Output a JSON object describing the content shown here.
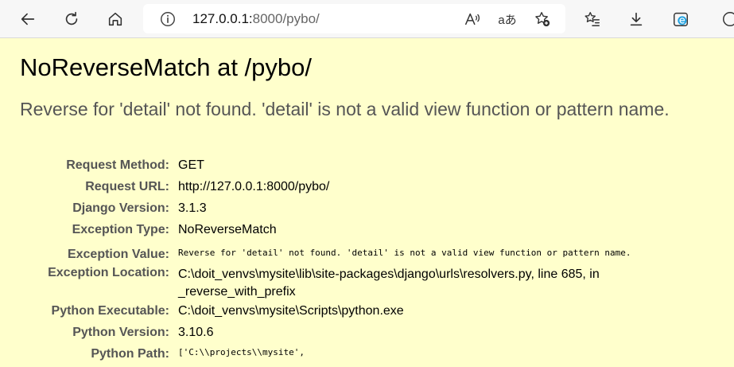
{
  "browser": {
    "address_host": "127.0.0.1:",
    "address_path": "8000/pybo/",
    "icons": {
      "back": "arrow-left-icon",
      "refresh": "refresh-icon",
      "home": "home-icon",
      "site_info": "info-icon",
      "read_aloud": "read-aloud-icon",
      "translate": "translate-icon",
      "favorite_add": "star-plus-icon",
      "favorites": "favorites-list-icon",
      "downloads": "download-icon",
      "edge": "edge-logo-icon"
    },
    "translate_glyph": "aあ"
  },
  "page": {
    "title": "NoReverseMatch at /pybo/",
    "exception_message": "Reverse for 'detail' not found. 'detail' is not a valid view function or pattern name.",
    "rows": [
      {
        "label": "Request Method:",
        "value": "GET"
      },
      {
        "label": "Request URL:",
        "value": "http://127.0.0.1:8000/pybo/"
      },
      {
        "label": "Django Version:",
        "value": "3.1.3"
      },
      {
        "label": "Exception Type:",
        "value": "NoReverseMatch"
      },
      {
        "label": "Exception Value:",
        "value": "Reverse for 'detail' not found. 'detail' is not a valid view function or pattern name."
      },
      {
        "label": "Exception Location:",
        "value": "C:\\doit_venvs\\mysite\\lib\\site-packages\\django\\urls\\resolvers.py, line 685, in _reverse_with_prefix"
      },
      {
        "label": "Python Executable:",
        "value": "C:\\doit_venvs\\mysite\\Scripts\\python.exe"
      },
      {
        "label": "Python Version:",
        "value": "3.10.6"
      },
      {
        "label": "Python Path:",
        "value": "['C:\\\\projects\\\\mysite',"
      }
    ]
  },
  "colors": {
    "page_bg": "#ffffcc",
    "label": "#555555",
    "toolbar_bg": "#f7f7f7"
  }
}
